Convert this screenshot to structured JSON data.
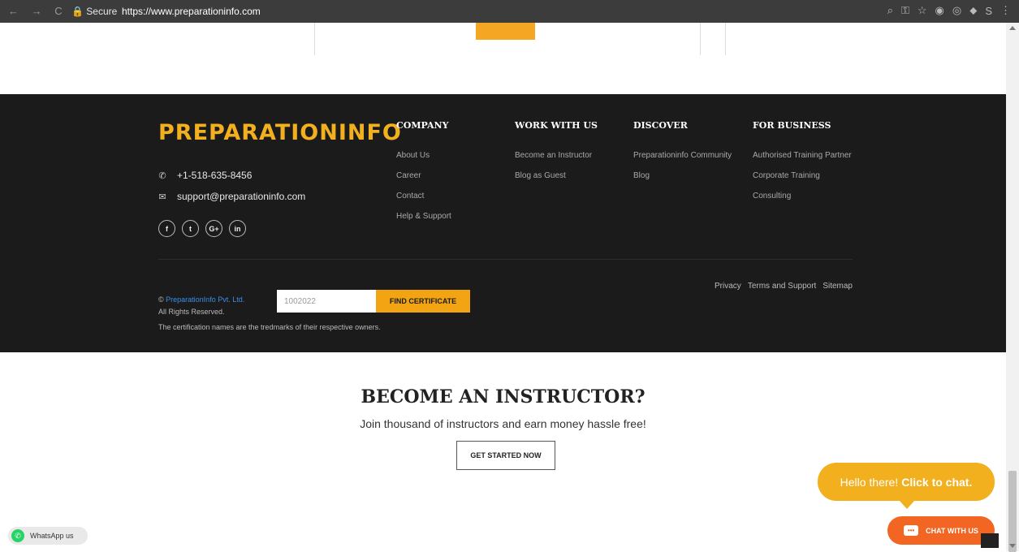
{
  "browser": {
    "nav_glyphs": "← → C",
    "secure_label": "🔒 Secure",
    "url": "https://www.preparationinfo.com",
    "tools": [
      "⌕",
      "⚿",
      "☆",
      "◉",
      "◎",
      "⬥",
      "S",
      "⋮"
    ]
  },
  "footer": {
    "logo": "PREPARATIONINFO",
    "phone": "+1-518-635-8456",
    "email": "support@preparationinfo.com",
    "social": [
      "f",
      "t",
      "G+",
      "in"
    ],
    "columns": [
      {
        "title": "COMPANY",
        "links": [
          "About Us",
          "Career",
          "Contact",
          "Help & Support"
        ]
      },
      {
        "title": "WORK WITH US",
        "links": [
          "Become an Instructor",
          "Blog as Guest"
        ]
      },
      {
        "title": "DISCOVER",
        "links": [
          "Preparationinfo Community",
          "Blog"
        ]
      },
      {
        "title": "FOR BUSINESS",
        "links": [
          "Authorised Training Partner",
          "Corporate Training",
          "Consulting"
        ]
      }
    ],
    "legal_links": [
      "Privacy",
      "Terms and Support",
      "Sitemap"
    ],
    "copyright_symbol": "©",
    "company": "PreparationInfo Pvt. Ltd.",
    "rights": "All Rights Reserved.",
    "cert_input_value": "1002022",
    "cert_button": "FIND CERTIFICATE",
    "trademark_note": "The certification names are the tredmarks of their respective owners."
  },
  "cta": {
    "title": "BECOME AN INSTRUCTOR?",
    "subtitle": "Join thousand of instructors and earn money hassle free!",
    "button": "GET STARTED NOW"
  },
  "widgets": {
    "whatsapp_label": "WhatsApp us",
    "chat_bubble_text": "Hello there!",
    "chat_bubble_bold": "Click to chat.",
    "chat_button": "CHAT WITH US"
  },
  "colors": {
    "accent": "#f2a413",
    "footer_bg": "#1b1b1b",
    "chat_orange": "#f26522",
    "link_blue": "#3b8ee6"
  }
}
